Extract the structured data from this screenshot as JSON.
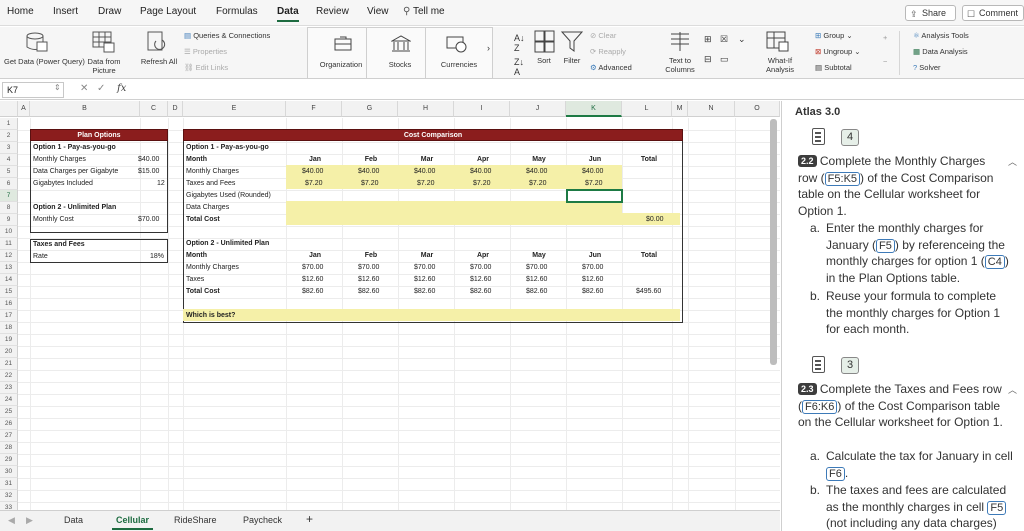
{
  "menu": {
    "tabs": [
      "Home",
      "Insert",
      "Draw",
      "Page Layout",
      "Formulas",
      "Data",
      "Review",
      "View"
    ],
    "tell_me": "Tell me",
    "share": "Share",
    "comment": "Comment"
  },
  "ribbon": {
    "get_data": "Get Data (Power Query)",
    "data_from_picture": "Data from Picture",
    "refresh_all": "Refresh All",
    "queries_connections": "Queries & Connections",
    "properties": "Properties",
    "edit_links": "Edit Links",
    "data_types": [
      "Organization",
      "Stocks",
      "Currencies"
    ],
    "sort": "Sort",
    "filter": "Filter",
    "clear": "Clear",
    "reapply": "Reapply",
    "advanced": "Advanced",
    "text_to_columns": "Text to Columns",
    "what_if": "What-If Analysis",
    "group": "Group",
    "ungroup": "Ungroup",
    "subtotal": "Subtotal",
    "analysis_tools": "Analysis Tools",
    "data_analysis": "Data Analysis",
    "solver": "Solver"
  },
  "formula_bar": {
    "name_box": "K7",
    "fx": "fx",
    "formula": ""
  },
  "columns": [
    "A",
    "B",
    "C",
    "D",
    "E",
    "F",
    "G",
    "H",
    "I",
    "J",
    "K",
    "L",
    "M",
    "N",
    "O"
  ],
  "rows": [
    "1",
    "2",
    "3",
    "4",
    "5",
    "6",
    "7",
    "8",
    "9",
    "10",
    "11",
    "12",
    "13",
    "14",
    "15",
    "16",
    "17",
    "18",
    "19",
    "20",
    "21",
    "22",
    "23",
    "24",
    "25",
    "26",
    "27",
    "28",
    "29",
    "30",
    "31",
    "32",
    "33"
  ],
  "plan": {
    "title": "Plan Options",
    "opt1_heading": "Option 1 - Pay-as-you-go",
    "monthly_charges_label": "Monthly Charges",
    "monthly_charges": "$40.00",
    "data_charges_label": "Data Charges per Gigabyte",
    "data_charges": "$15.00",
    "gigabytes_label": "Gigabytes Included",
    "gigabytes": "12",
    "opt2_heading": "Option 2 - Unlimited Plan",
    "monthly_cost_label": "Monthly Cost",
    "monthly_cost": "$70.00",
    "taxes_heading": "Taxes and Fees",
    "rate_label": "Rate",
    "rate": "18%"
  },
  "comparison": {
    "title": "Cost Comparison",
    "months": [
      "Jan",
      "Feb",
      "Mar",
      "Apr",
      "May",
      "Jun"
    ],
    "total_label": "Total",
    "opt1": {
      "heading": "Option 1 - Pay-as-you-go",
      "month_label": "Month",
      "labels": [
        "Monthly Charges",
        "Taxes and Fees",
        "Gigabytes Used (Rounded)",
        "Data Charges",
        "Total Cost"
      ],
      "monthly_charges": [
        "$40.00",
        "$40.00",
        "$40.00",
        "$40.00",
        "$40.00",
        "$40.00"
      ],
      "taxes": [
        "$7.20",
        "$7.20",
        "$7.20",
        "$7.20",
        "$7.20",
        "$7.20"
      ],
      "total": "$0.00"
    },
    "opt2": {
      "heading": "Option 2 - Unlimited Plan",
      "month_label": "Month",
      "labels": [
        "Monthly Charges",
        "Taxes",
        "Total Cost"
      ],
      "monthly_charges": [
        "$70.00",
        "$70.00",
        "$70.00",
        "$70.00",
        "$70.00",
        "$70.00"
      ],
      "taxes": [
        "$12.60",
        "$12.60",
        "$12.60",
        "$12.60",
        "$12.60",
        "$12.60"
      ],
      "total_cost": [
        "$82.60",
        "$82.60",
        "$82.60",
        "$82.60",
        "$82.60",
        "$82.60"
      ],
      "total": "$495.60"
    },
    "which_best": "Which is best?"
  },
  "sheet_tabs": [
    "Data",
    "Cellular",
    "RideShare",
    "Paycheck"
  ],
  "active_sheet": "Cellular",
  "panel": {
    "title": "Atlas 3.0",
    "badge1": "4",
    "step1_tag": "2.2",
    "step1_intro_a": "Complete the Monthly Charges row (",
    "step1_ref": "F5:K5",
    "step1_intro_b": ") of the Cost Comparison table on the Cellular worksheet for Option 1.",
    "step1_a_1": "Enter the monthly charges for January (",
    "step1_a_ref1": "F5",
    "step1_a_2": ") by referenceing the monthly charges for option 1 (",
    "step1_a_ref2": "C4",
    "step1_a_3": ") in the Plan Options table.",
    "step1_b": "Reuse your formula to complete the monthly charges for Option 1 for each month.",
    "badge2": "3",
    "step2_tag": "2.3",
    "step2_intro_a": "Complete the Taxes and Fees row (",
    "step2_ref": "F6:K6",
    "step2_intro_b": ") of the Cost Comparison table on the Cellular worksheet for Option 1.",
    "step2_a_1": "Calculate the tax for January in cell ",
    "step2_a_ref": "F6",
    "step2_a_2": ".",
    "step2_b_1": "The taxes and fees are calculated as the monthly charges in cell ",
    "step2_b_ref": "F5",
    "step2_b_2": " (not including any data charges)"
  }
}
